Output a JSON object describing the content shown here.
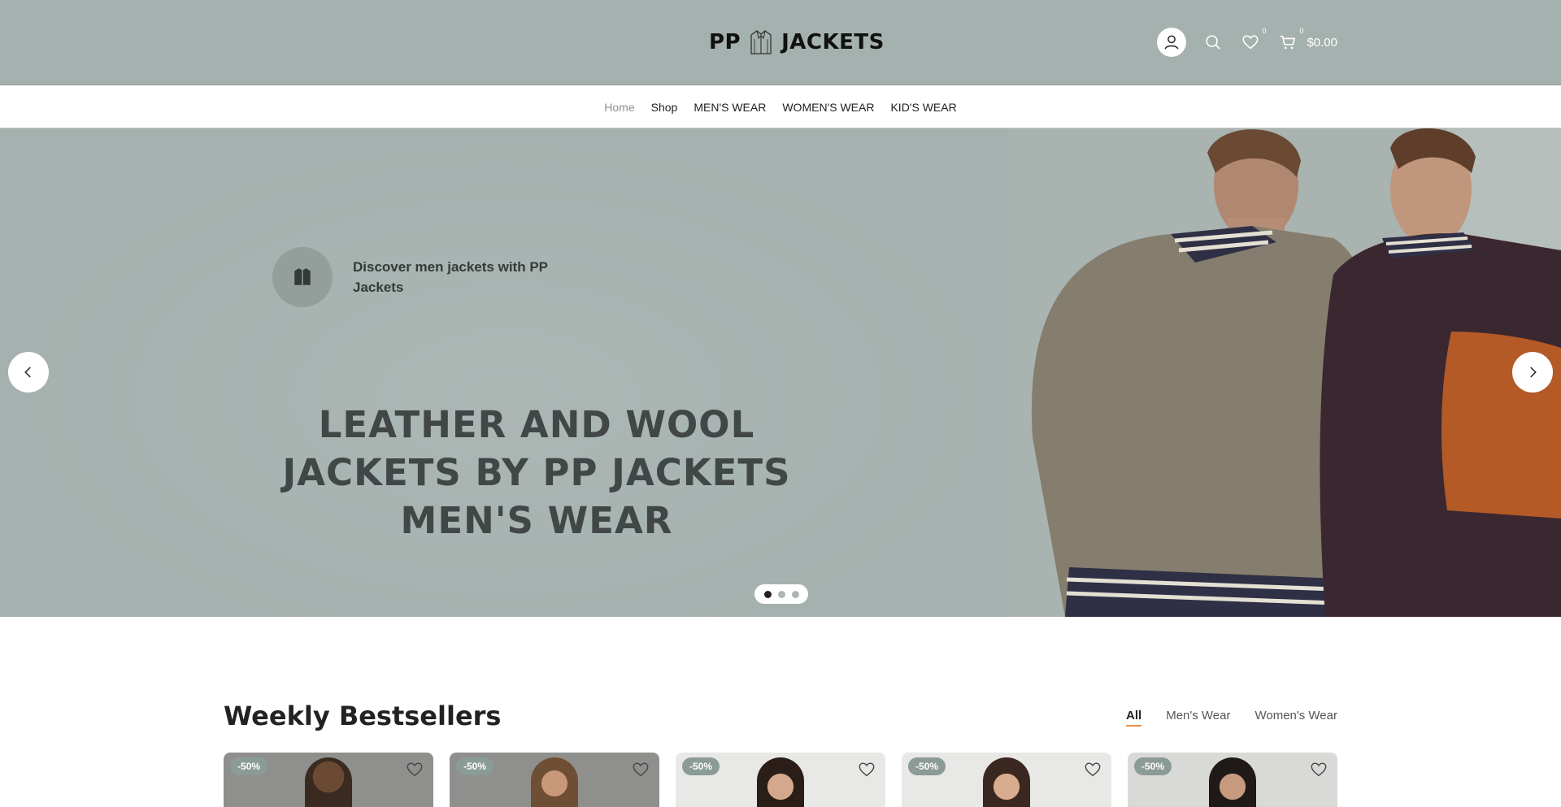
{
  "header": {
    "logo_left": "PP",
    "logo_right": "JACKETS",
    "wishlist_count": "0",
    "cart_count": "0",
    "cart_total": "$0.00"
  },
  "nav": {
    "items": [
      "Home",
      "Shop",
      "MEN'S WEAR",
      "WOMEN'S WEAR",
      "KID'S WEAR"
    ],
    "current": "Home"
  },
  "hero": {
    "subtitle": "Discover men jackets with PP Jackets",
    "title": "LEATHER AND WOOL JACKETS BY PP JACKETS MEN'S WEAR",
    "slides_total": 3,
    "active_slide": 1
  },
  "bestsellers": {
    "title": "Weekly Bestsellers",
    "filters": [
      "All",
      "Men's Wear",
      "Women's Wear"
    ],
    "active_filter": "All",
    "products": [
      {
        "badge": "-50%"
      },
      {
        "badge": "-50%"
      },
      {
        "badge": "-50%"
      },
      {
        "badge": "-50%"
      },
      {
        "badge": "-50%"
      }
    ]
  },
  "colors": {
    "header_bg": "#a5b1ae",
    "accent_underline": "#e09150",
    "sale_badge": "#8b9b96"
  },
  "icons": [
    "user-icon",
    "search-icon",
    "heart-icon",
    "cart-icon",
    "jacket-icon",
    "chevron-left-icon",
    "chevron-right-icon"
  ]
}
